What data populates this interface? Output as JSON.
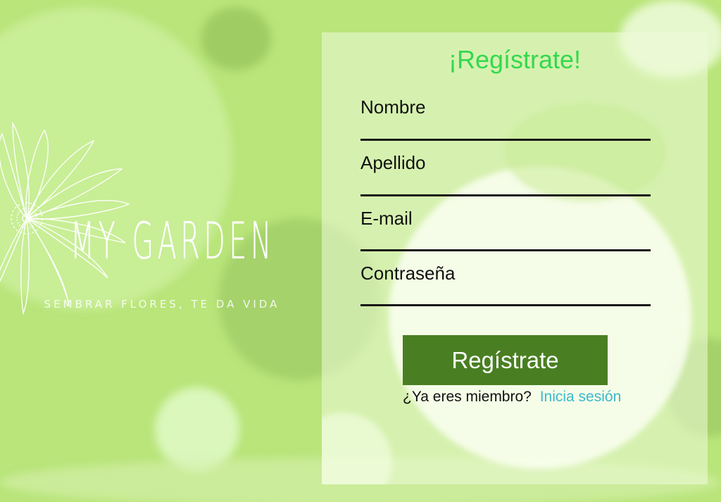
{
  "brand": {
    "name": "MY GARDEN",
    "tagline": "SEMBRAR FLORES, TE DA VIDA",
    "logo_icon": "daisy-icon"
  },
  "form": {
    "title": "¡Regístrate!",
    "fields": [
      {
        "label": "Nombre",
        "value": ""
      },
      {
        "label": "Apellido",
        "value": ""
      },
      {
        "label": "E-mail",
        "value": ""
      },
      {
        "label": "Contraseña",
        "value": ""
      }
    ],
    "submit_label": "Regístrate",
    "member_text": "¿Ya eres miembro?",
    "login_link": "Inicia sesión"
  },
  "colors": {
    "background": "#b9e57a",
    "title": "#34d84e",
    "button": "#497f22",
    "link": "#3bb9cf"
  }
}
